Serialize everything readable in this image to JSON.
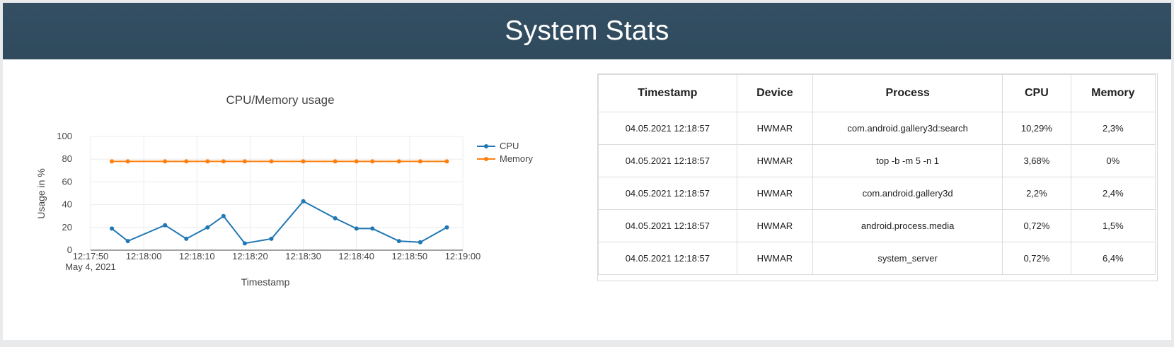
{
  "header": {
    "title": "System Stats"
  },
  "chart_data": {
    "type": "line",
    "title": "CPU/Memory usage",
    "xlabel": "Timestamp",
    "ylabel": "Usage in %",
    "ylim": [
      0,
      100
    ],
    "xlim": [
      "12:17:50",
      "12:19:00"
    ],
    "y_ticks": [
      "0",
      "20",
      "40",
      "60",
      "80",
      "100"
    ],
    "x_ticks": [
      "12:17:50",
      "12:18:00",
      "12:18:10",
      "12:18:20",
      "12:18:30",
      "12:18:40",
      "12:18:50",
      "12:19:00"
    ],
    "x_tick_sublabel": "May 4, 2021",
    "grid": true,
    "legend_position": "top-right",
    "x": [
      "12:17:54",
      "12:17:57",
      "12:18:04",
      "12:18:08",
      "12:18:12",
      "12:18:15",
      "12:18:19",
      "12:18:24",
      "12:18:30",
      "12:18:36",
      "12:18:40",
      "12:18:43",
      "12:18:48",
      "12:18:52",
      "12:18:57"
    ],
    "series": [
      {
        "name": "CPU",
        "color": "#1f77b4",
        "values": [
          19,
          8,
          22,
          10,
          20,
          30,
          6,
          10,
          43,
          28,
          19,
          19,
          8,
          7,
          20
        ]
      },
      {
        "name": "Memory",
        "color": "#ff7f0e",
        "values": [
          78,
          78,
          78,
          78,
          78,
          78,
          78,
          78,
          78,
          78,
          78,
          78,
          78,
          78,
          78
        ]
      }
    ]
  },
  "table": {
    "headers": [
      "Timestamp",
      "Device",
      "Process",
      "CPU",
      "Memory"
    ],
    "rows": [
      [
        "04.05.2021 12:18:57",
        "HWMAR",
        "com.android.gallery3d:search",
        "10,29%",
        "2,3%"
      ],
      [
        "04.05.2021 12:18:57",
        "HWMAR",
        "top -b -m 5 -n 1",
        "3,68%",
        "0%"
      ],
      [
        "04.05.2021 12:18:57",
        "HWMAR",
        "com.android.gallery3d",
        "2,2%",
        "2,4%"
      ],
      [
        "04.05.2021 12:18:57",
        "HWMAR",
        "android.process.media",
        "0,72%",
        "1,5%"
      ],
      [
        "04.05.2021 12:18:57",
        "HWMAR",
        "system_server",
        "0,72%",
        "6,4%"
      ]
    ]
  }
}
